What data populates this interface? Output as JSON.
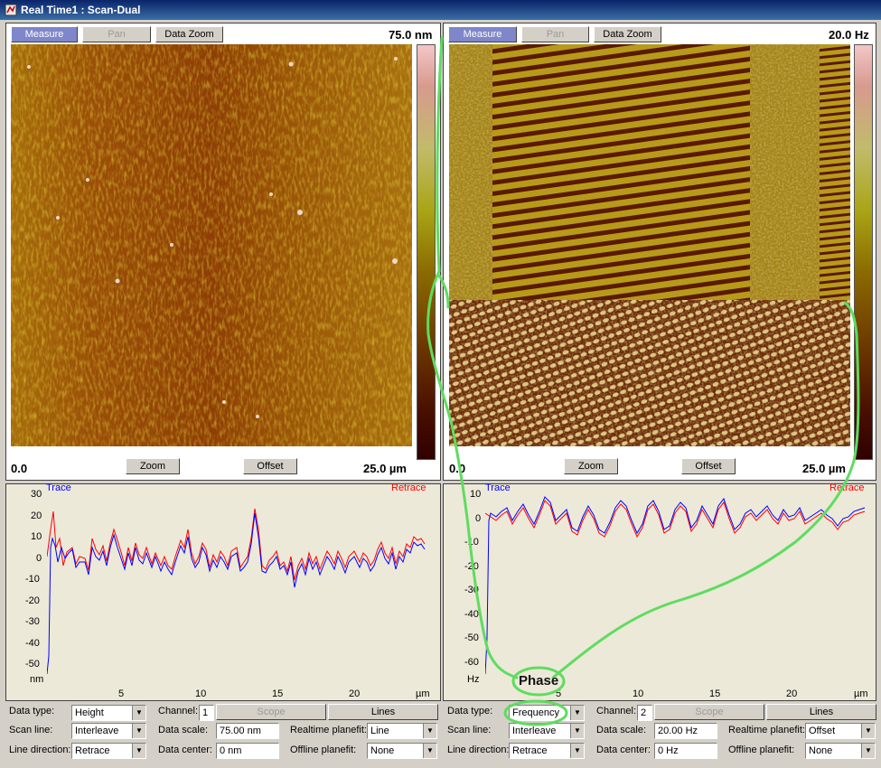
{
  "window": {
    "title": "Real Time1 : Scan-Dual"
  },
  "left_image": {
    "buttons": {
      "measure": "Measure",
      "pan": "Pan",
      "data_zoom": "Data Zoom",
      "zoom": "Zoom",
      "offset": "Offset"
    },
    "scale_max": "75.0 nm",
    "axis_start": "0.0",
    "axis_end": "25.0 µm"
  },
  "right_image": {
    "buttons": {
      "measure": "Measure",
      "pan": "Pan",
      "data_zoom": "Data Zoom",
      "zoom": "Zoom",
      "offset": "Offset"
    },
    "scale_max": "20.0 Hz",
    "axis_start": "0.0",
    "axis_end": "25.0 µm"
  },
  "left_plot": {
    "trace_label": "Trace",
    "retrace_label": "Retrace",
    "y_unit": "nm",
    "x_unit": "µm",
    "y_ticks": [
      "30",
      "20",
      "10",
      "0",
      "-10",
      "-20",
      "-30",
      "-40",
      "-50"
    ],
    "x_ticks": [
      "5",
      "10",
      "15",
      "20"
    ]
  },
  "right_plot": {
    "trace_label": "Trace",
    "retrace_label": "Retrace",
    "y_unit": "Hz",
    "x_unit": "µm",
    "y_ticks": [
      "10",
      "0",
      "-10",
      "-20",
      "-30",
      "-40",
      "-50",
      "-60"
    ],
    "x_ticks": [
      "5",
      "10",
      "15",
      "20"
    ]
  },
  "annotation": {
    "text": "Phase"
  },
  "left_controls": {
    "data_type_label": "Data type:",
    "data_type_value": "Height",
    "channel_label": "Channel:",
    "channel_value": "1",
    "scope_button": "Scope",
    "lines_button": "Lines",
    "scan_line_label": "Scan line:",
    "scan_line_value": "Interleave",
    "data_scale_label": "Data scale:",
    "data_scale_value": "75.00 nm",
    "realtime_planefit_label": "Realtime planefit:",
    "realtime_planefit_value": "Line",
    "line_direction_label": "Line direction:",
    "line_direction_value": "Retrace",
    "data_center_label": "Data center:",
    "data_center_value": "0 nm",
    "offline_planefit_label": "Offline planefit:",
    "offline_planefit_value": "None"
  },
  "right_controls": {
    "data_type_label": "Data type:",
    "data_type_value": "Frequency",
    "channel_label": "Channel:",
    "channel_value": "2",
    "scope_button": "Scope",
    "lines_button": "Lines",
    "scan_line_label": "Scan line:",
    "scan_line_value": "Interleave",
    "data_scale_label": "Data scale:",
    "data_scale_value": "20.00 Hz",
    "realtime_planefit_label": "Realtime planefit:",
    "realtime_planefit_value": "Offset",
    "line_direction_label": "Line direction:",
    "line_direction_value": "Retrace",
    "data_center_label": "Data center:",
    "data_center_value": "0 Hz",
    "offline_planefit_label": "Offline planefit:",
    "offline_planefit_value": "None"
  },
  "colors": {
    "trace": "#0000ff",
    "retrace": "#ff0000",
    "highlight": "#5fdc5f",
    "active_button": "#7f86c9"
  },
  "icons": {
    "window": "app-window-icon",
    "dropdown": "chevron-down-icon"
  }
}
